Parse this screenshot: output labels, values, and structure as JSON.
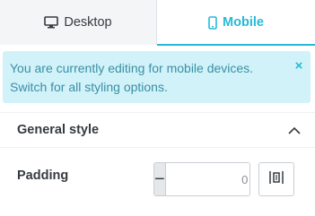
{
  "tabs": [
    {
      "label": "Desktop",
      "icon": "desktop-icon",
      "active": false
    },
    {
      "label": "Mobile",
      "icon": "mobile-icon",
      "active": true
    }
  ],
  "alert": {
    "line1": "You are currently editing for mobile devices.",
    "line2": "Switch for all styling options.",
    "close_icon": "×"
  },
  "section": {
    "title": "General style",
    "expanded": true
  },
  "padding": {
    "label": "Padding",
    "value": "0",
    "minus": "−",
    "plus": "+",
    "link_icon": "link-sides-icon"
  },
  "colors": {
    "accent": "#25b9d7",
    "alert_bg": "#d1f2f9",
    "alert_text": "#3a8fa5",
    "text": "#363a41"
  }
}
